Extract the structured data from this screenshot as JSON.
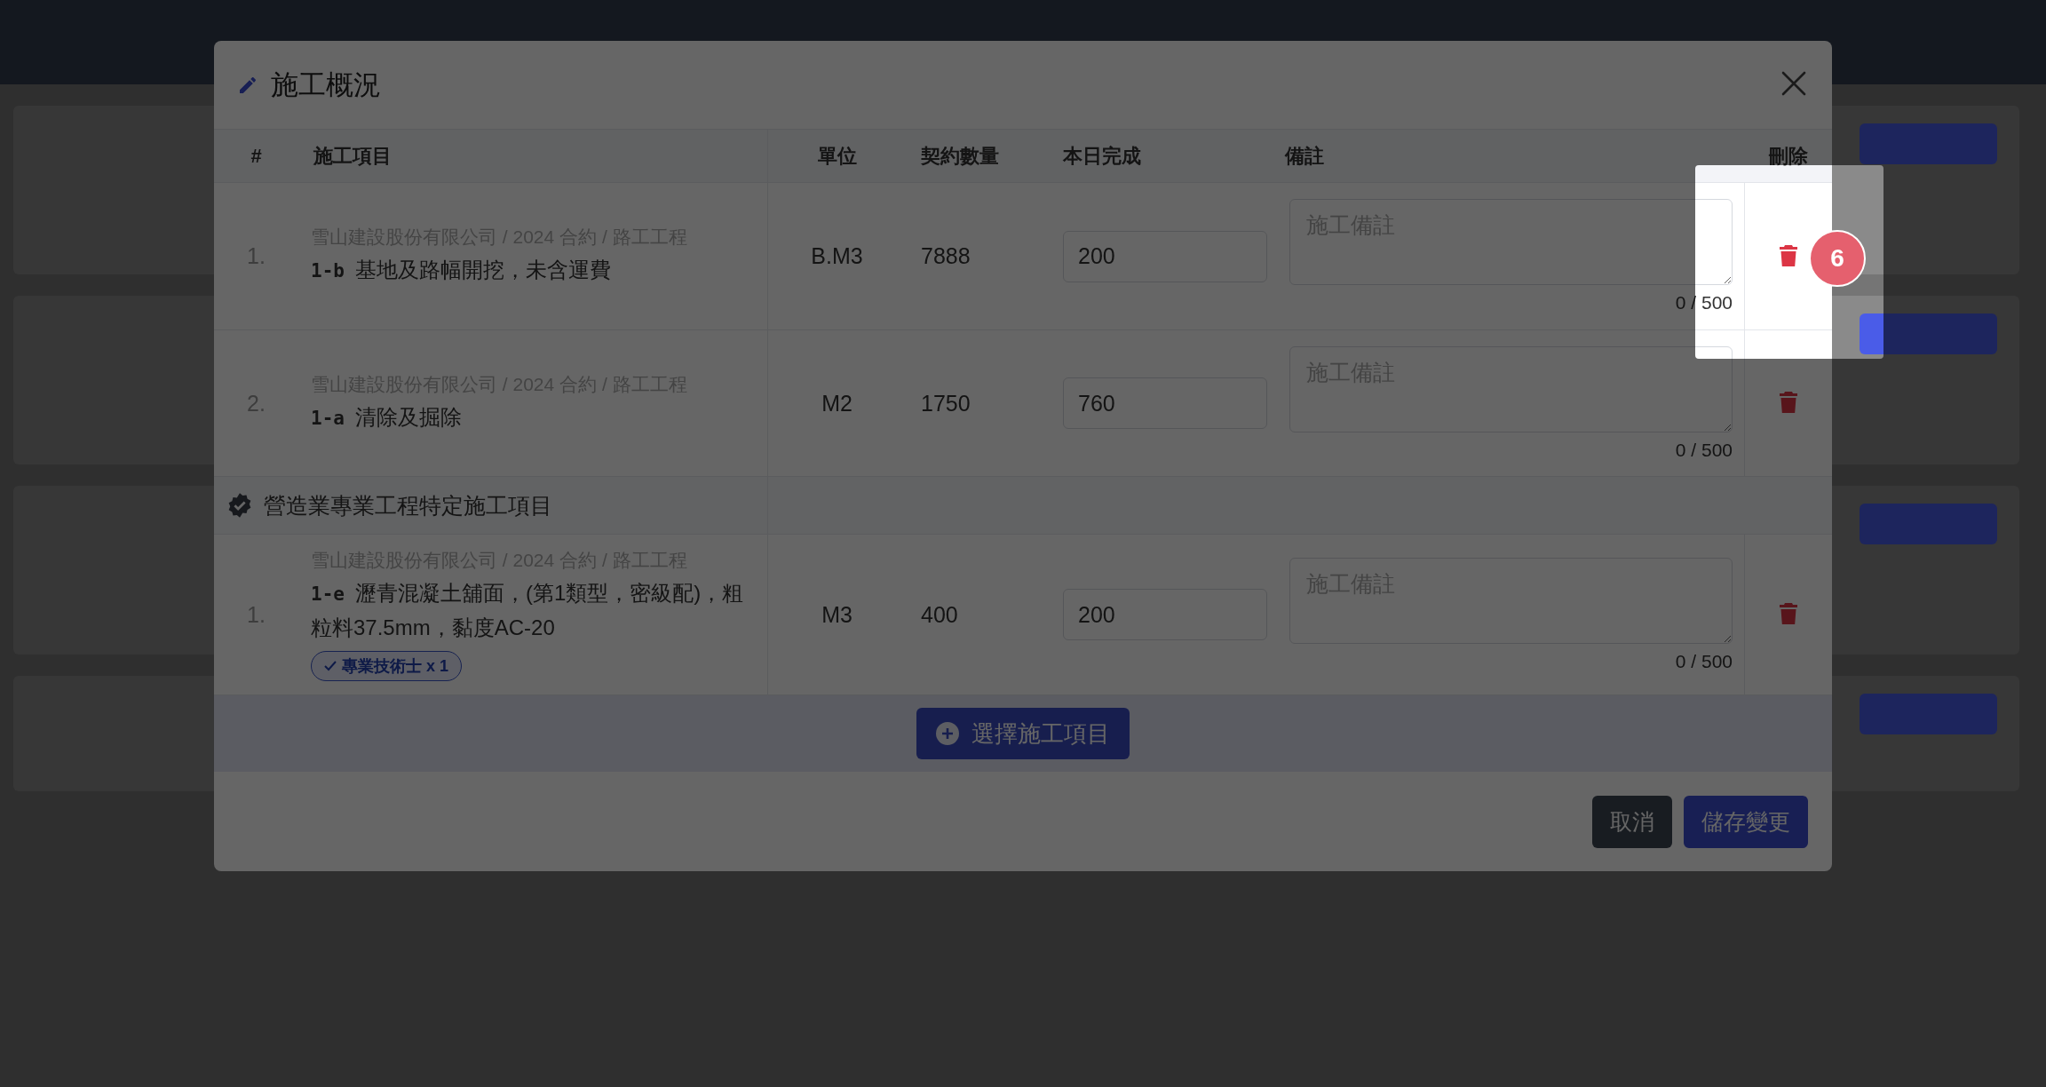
{
  "dialog": {
    "title": "施工概況",
    "columns": [
      "#",
      "施工項目",
      "單位",
      "契約數量",
      "本日完成",
      "備註",
      "刪除"
    ],
    "rows": [
      {
        "kind": "item",
        "index": "1.",
        "path": "雪山建設股份有限公司 / 2024 合約 / 路工工程",
        "code": "1-b",
        "name": "基地及路幅開挖，未含運費",
        "unit": "B.M3",
        "quantity": "7888",
        "today": "200",
        "note_placeholder": "施工備註",
        "counter": "0 / 500"
      },
      {
        "kind": "item",
        "index": "2.",
        "path": "雪山建設股份有限公司 / 2024 合約 / 路工工程",
        "code": "1-a",
        "name": "清除及掘除",
        "unit": "M2",
        "quantity": "1750",
        "today": "760",
        "note_placeholder": "施工備註",
        "counter": "0 / 500"
      },
      {
        "kind": "group",
        "label": "營造業專業工程特定施工項目"
      },
      {
        "kind": "item",
        "index": "1.",
        "path": "雪山建設股份有限公司 / 2024 合約 / 路工工程",
        "code": "1-e",
        "name": "瀝青混凝土舖面，(第1類型，密級配)，粗粒料37.5mm，黏度AC-20",
        "unit": "M3",
        "quantity": "400",
        "today": "200",
        "note_placeholder": "施工備註",
        "counter": "0 / 500",
        "tags": [
          "專業技術士 x 1"
        ]
      }
    ],
    "add_button": "選擇施工項目",
    "buttons": [
      {
        "kind": "secondary",
        "label": "取消"
      },
      {
        "kind": "primary",
        "label": "儲存變更"
      }
    ]
  },
  "tour": {
    "step": "6"
  }
}
